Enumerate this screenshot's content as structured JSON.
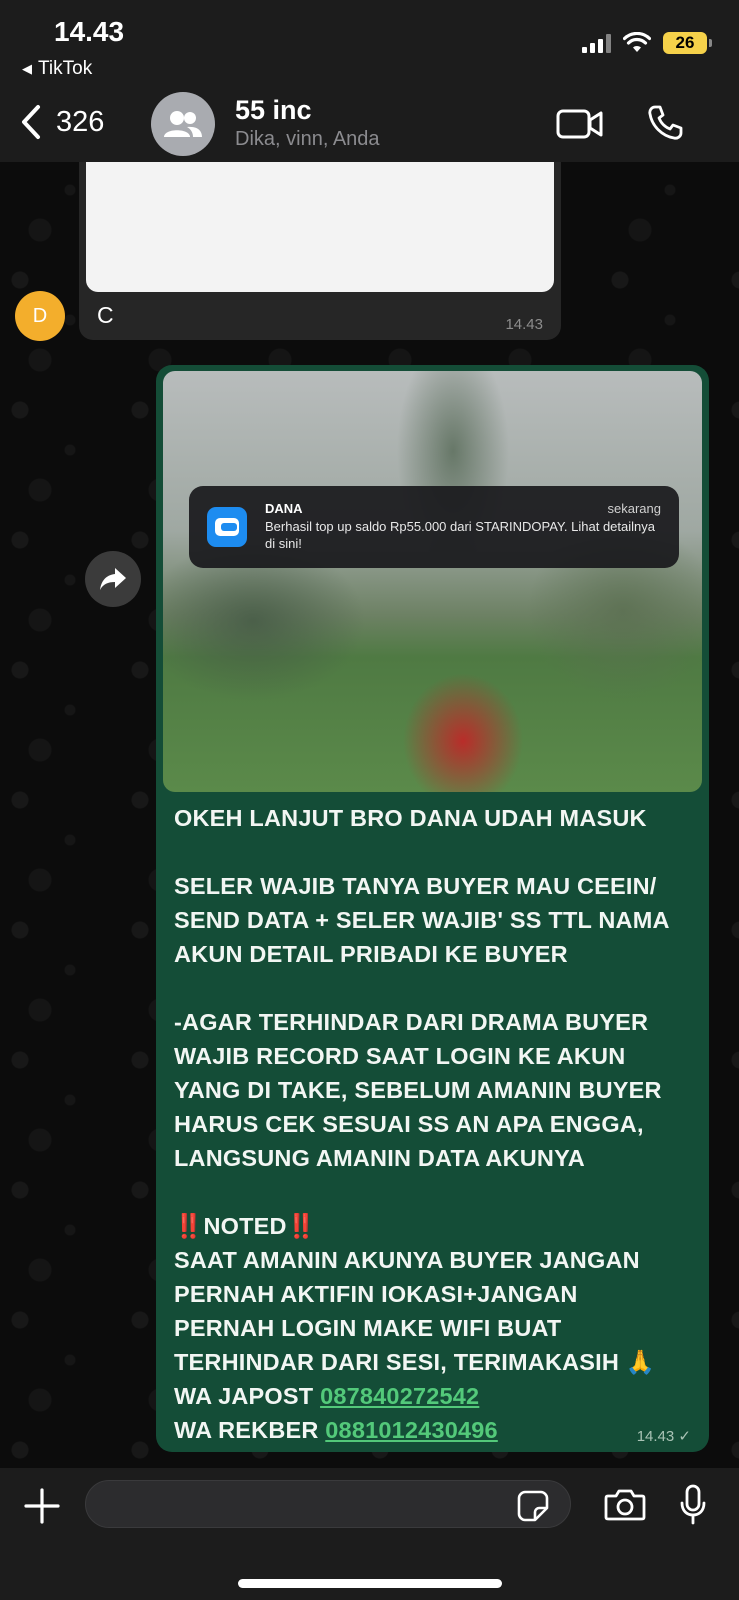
{
  "status_bar": {
    "time": "14.43",
    "back_app": "TikTok",
    "battery": "26"
  },
  "header": {
    "back_count": "326",
    "group_name": "55 inc",
    "members": "Dika, vinn, Anda"
  },
  "incoming": {
    "sender_initial": "D",
    "text": "C",
    "time": "14.43"
  },
  "outgoing": {
    "notification": {
      "app": "DANA",
      "when": "sekarang",
      "body": "Berhasil top up saldo Rp55.000 dari STARINDOPAY. Lihat detailnya di sini!"
    },
    "lines": {
      "l1": "OKEH LANJUT BRO DANA UDAH MASUK",
      "l2": "SELER WAJIB TANYA BUYER MAU CEEIN/",
      "l3": "SEND DATA + SELER WAJIB' SS TTL NAMA",
      "l4": "AKUN DETAIL PRIBADI KE BUYER",
      "l5": "-AGAR TERHINDAR DARI DRAMA BUYER",
      "l6": "WAJIB RECORD SAAT LOGIN KE AKUN",
      "l7": "YANG DI TAKE, SEBELUM AMANIN BUYER",
      "l8": "HARUS CEK SESUAI SS AN APA ENGGA,",
      "l9": "LANGSUNG AMANIN DATA AKUNYA",
      "noted_emoji": "‼️",
      "noted": "NOTED",
      "l11": "SAAT AMANIN AKUNYA BUYER JANGAN",
      "l12": "PERNAH AKTIFIN IOKASI+JANGAN",
      "l13": "PERNAH LOGIN MAKE WIFI BUAT",
      "l14": "TERHINDAR DARI SESI, TERIMAKASIH",
      "pray_emoji": "🙏",
      "japost_label": "WA JAPOST",
      "japost_number": "087840272542",
      "rekber_label": "WA REKBER",
      "rekber_number": "0881012430496"
    },
    "time": "14.43",
    "status_mark": "✓"
  },
  "input": {
    "placeholder": ""
  },
  "colors": {
    "outgoing_bubble": "#144d37",
    "incoming_bubble": "#262626",
    "link": "#53c97a",
    "avatar": "#f3ae2c",
    "battery": "#f5d14a"
  }
}
